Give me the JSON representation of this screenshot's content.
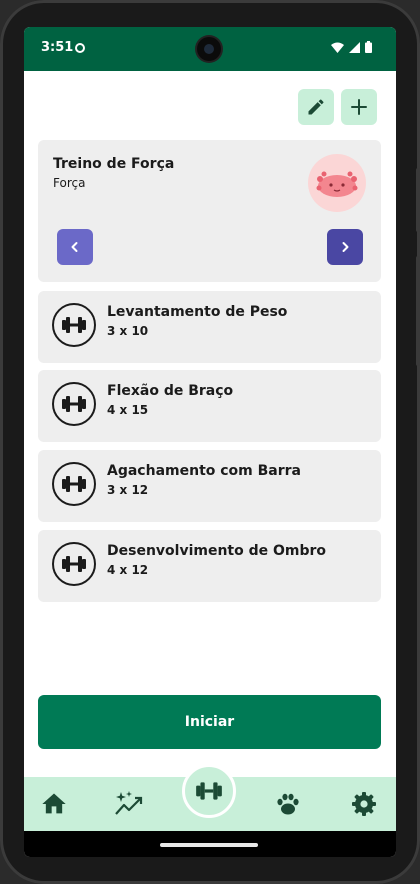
{
  "status_bar": {
    "time": "3:51"
  },
  "colors": {
    "accent_green": "#006241",
    "button_green": "#007a55",
    "mint": "#c8efd9",
    "nav_prev": "#6b69c8",
    "nav_next": "#4a47a3"
  },
  "toolbar": {
    "edit_icon": "pencil-icon",
    "add_icon": "plus-icon"
  },
  "workout": {
    "title": "Treino de Força",
    "category": "Força",
    "mascot_icon": "axolotl-mascot-icon"
  },
  "exercises": [
    {
      "name": "Levantamento de Peso",
      "detail": "3 x 10",
      "icon": "dumbbell-icon"
    },
    {
      "name": "Flexão de Braço",
      "detail": "4 x 15",
      "icon": "dumbbell-icon"
    },
    {
      "name": "Agachamento com Barra",
      "detail": "3 x 12",
      "icon": "dumbbell-icon"
    },
    {
      "name": "Desenvolvimento de Ombro",
      "detail": "4 x 12",
      "icon": "dumbbell-icon"
    }
  ],
  "start_button": {
    "label": "Iniciar"
  },
  "bottom_nav": {
    "items": [
      {
        "icon": "home-icon"
      },
      {
        "icon": "sparkle-chart-icon"
      },
      {
        "icon": "dumbbell-icon",
        "active": true
      },
      {
        "icon": "paw-icon"
      },
      {
        "icon": "gear-icon"
      }
    ]
  }
}
